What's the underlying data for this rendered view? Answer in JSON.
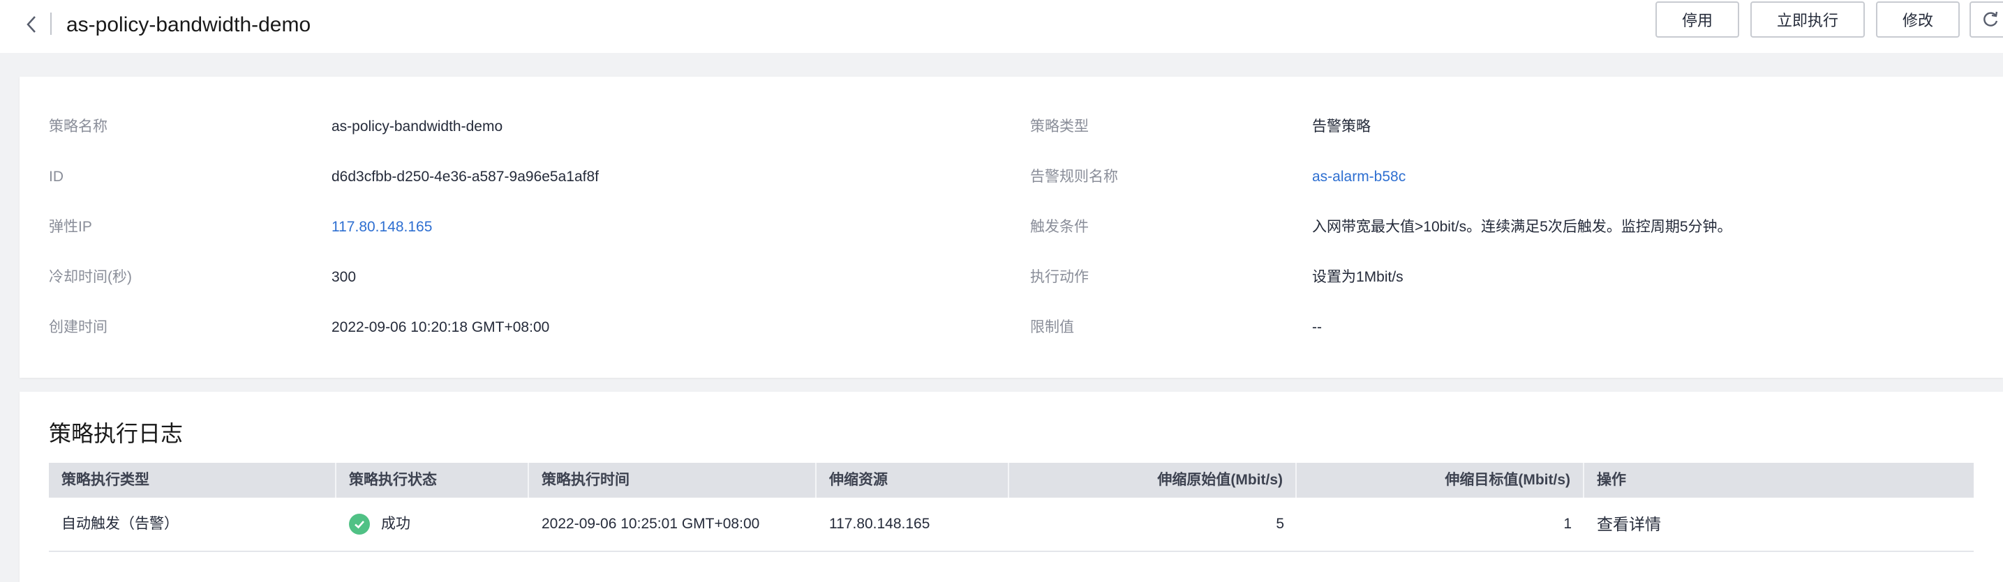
{
  "header": {
    "title": "as-policy-bandwidth-demo",
    "buttons": {
      "disable": "停用",
      "execute": "立即执行",
      "edit": "修改"
    }
  },
  "details": {
    "left": [
      {
        "label": "策略名称",
        "value": "as-policy-bandwidth-demo"
      },
      {
        "label": "ID",
        "value": "d6d3cfbb-d250-4e36-a587-9a96e5a1af8f"
      },
      {
        "label": "弹性IP",
        "value": "117.80.148.165"
      },
      {
        "label": "冷却时间(秒)",
        "value": "300"
      },
      {
        "label": "创建时间",
        "value": "2022-09-06 10:20:18 GMT+08:00"
      }
    ],
    "right": [
      {
        "label": "策略类型",
        "value": "告警策略"
      },
      {
        "label": "告警规则名称",
        "value": "as-alarm-b58c"
      },
      {
        "label": "触发条件",
        "value": "入网带宽最大值>10bit/s。连续满足5次后触发。监控周期5分钟。"
      },
      {
        "label": "执行动作",
        "value": "设置为1Mbit/s"
      },
      {
        "label": "限制值",
        "value": "--"
      }
    ]
  },
  "log": {
    "title": "策略执行日志",
    "columns": [
      "策略执行类型",
      "策略执行状态",
      "策略执行时间",
      "伸缩资源",
      "伸缩原始值(Mbit/s)",
      "伸缩目标值(Mbit/s)",
      "操作"
    ],
    "rows": [
      {
        "type": "自动触发（告警）",
        "status": "成功",
        "time": "2022-09-06 10:25:01 GMT+08:00",
        "resource": "117.80.148.165",
        "original": "5",
        "target": "1",
        "action": "查看详情"
      }
    ]
  },
  "colors": {
    "link": "#2e6fd1",
    "success": "#50c185"
  }
}
